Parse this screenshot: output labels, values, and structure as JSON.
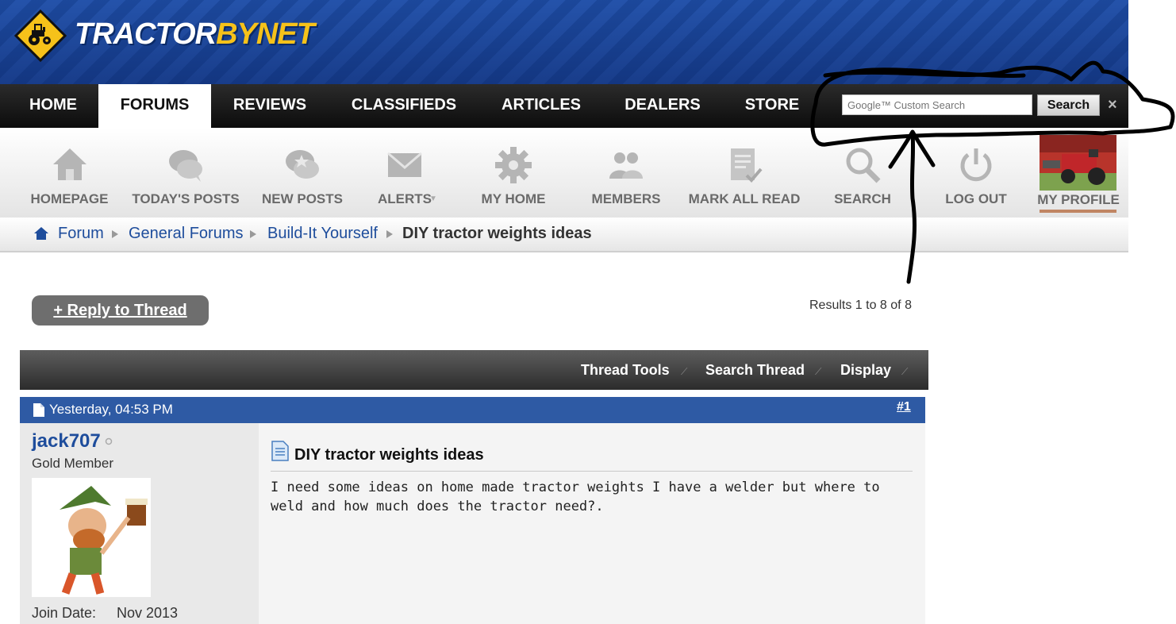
{
  "header": {
    "logo_part1": "TRACTOR",
    "logo_part2": "BYNET"
  },
  "main_nav": {
    "items": [
      {
        "label": "HOME"
      },
      {
        "label": "FORUMS",
        "active": true
      },
      {
        "label": "REVIEWS"
      },
      {
        "label": "CLASSIFIEDS"
      },
      {
        "label": "ARTICLES"
      },
      {
        "label": "DEALERS"
      },
      {
        "label": "STORE"
      }
    ],
    "search": {
      "placeholder": "Google™ Custom Search",
      "button_label": "Search",
      "close_label": "×"
    }
  },
  "toolbar": {
    "items": [
      {
        "label": "HOMEPAGE",
        "icon": "house-icon"
      },
      {
        "label": "TODAY'S POSTS",
        "icon": "speech-bubbles-icon"
      },
      {
        "label": "NEW POSTS",
        "icon": "star-bubble-icon"
      },
      {
        "label": "ALERTS",
        "icon": "envelope-icon"
      },
      {
        "label": "MY HOME",
        "icon": "gear-icon"
      },
      {
        "label": "MEMBERS",
        "icon": "people-icon"
      },
      {
        "label": "MARK ALL READ",
        "icon": "document-check-icon"
      },
      {
        "label": "SEARCH",
        "icon": "magnifier-icon"
      },
      {
        "label": "LOG OUT",
        "icon": "power-icon"
      }
    ],
    "profile_label": "MY PROFILE"
  },
  "breadcrumb": {
    "items": [
      "Forum",
      "General Forums",
      "Build-It Yourself"
    ],
    "current": "DIY tractor weights ideas"
  },
  "thread": {
    "reply_label": "+ Reply to Thread",
    "results": "Results 1 to 8 of 8",
    "tools": [
      "Thread Tools",
      "Search Thread",
      "Display"
    ]
  },
  "post": {
    "date": "Yesterday, 04:53 PM",
    "number": "#1",
    "username": "jack707",
    "user_title": "Gold Member",
    "join_date_label": "Join Date:",
    "join_date_value": "Nov 2013",
    "title": "DIY tractor weights ideas",
    "body": "I need some ideas on home made tractor weights I have a welder but where to weld and how much does the tractor need?."
  },
  "colors": {
    "banner_blue": "#1e4da3",
    "link_blue": "#1e4d9c",
    "post_header_blue": "#2e5aa4",
    "logo_yellow": "#f6c21a"
  }
}
